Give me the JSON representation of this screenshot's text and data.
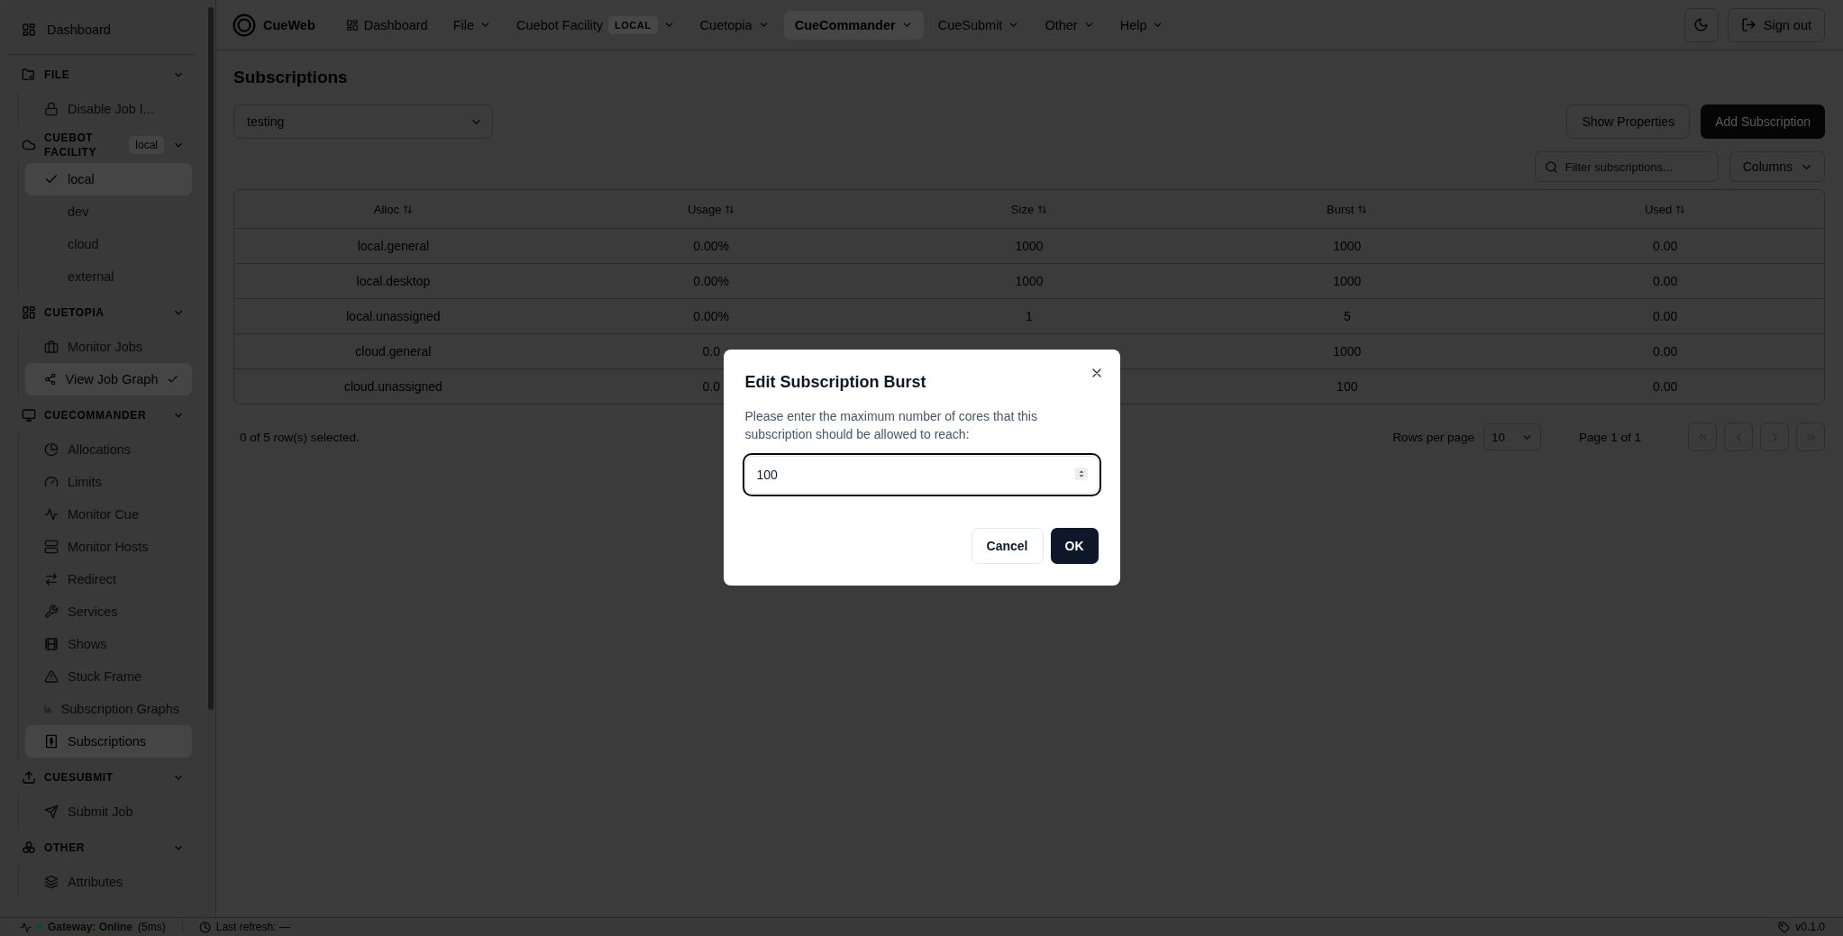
{
  "topbar": {
    "app_name": "CueWeb",
    "nav": [
      {
        "label": "Dashboard",
        "kind": "link",
        "selected": false
      },
      {
        "label": "File",
        "kind": "menu",
        "selected": false
      },
      {
        "label": "Cuebot Facility",
        "badge": "LOCAL",
        "kind": "menu",
        "selected": false
      },
      {
        "label": "Cuetopia",
        "kind": "menu",
        "selected": false
      },
      {
        "label": "CueCommander",
        "kind": "menu",
        "selected": true
      },
      {
        "label": "CueSubmit",
        "kind": "menu",
        "selected": false
      },
      {
        "label": "Other",
        "kind": "menu",
        "selected": false
      },
      {
        "label": "Help",
        "kind": "menu",
        "selected": false
      }
    ],
    "sign_out": "Sign out"
  },
  "sidebar": {
    "top_item": "Dashboard",
    "sections": [
      {
        "title": "FILE",
        "expanded": true,
        "items": [
          {
            "label": "Disable Job I...",
            "kind": "link",
            "selected": false,
            "checked": false
          }
        ]
      },
      {
        "title": "CUEBOT FACILITY",
        "badge": "local",
        "expanded": true,
        "items": [
          {
            "label": "local",
            "kind": "option",
            "selected": true,
            "checked": true
          },
          {
            "label": "dev",
            "kind": "option",
            "selected": false,
            "checked": false
          },
          {
            "label": "cloud",
            "kind": "option",
            "selected": false,
            "checked": false
          },
          {
            "label": "external",
            "kind": "option",
            "selected": false,
            "checked": false
          }
        ]
      },
      {
        "title": "CUETOPIA",
        "expanded": true,
        "items": [
          {
            "label": "Monitor Jobs",
            "kind": "link",
            "selected": false,
            "checked": false
          },
          {
            "label": "View Job Graph",
            "kind": "link",
            "selected": true,
            "checked": true
          }
        ]
      },
      {
        "title": "CUECOMMANDER",
        "expanded": true,
        "items": [
          {
            "label": "Allocations",
            "kind": "link",
            "selected": false,
            "checked": false
          },
          {
            "label": "Limits",
            "kind": "link",
            "selected": false,
            "checked": false
          },
          {
            "label": "Monitor Cue",
            "kind": "link",
            "selected": false,
            "checked": false
          },
          {
            "label": "Monitor Hosts",
            "kind": "link",
            "selected": false,
            "checked": false
          },
          {
            "label": "Redirect",
            "kind": "link",
            "selected": false,
            "checked": false
          },
          {
            "label": "Services",
            "kind": "link",
            "selected": false,
            "checked": false
          },
          {
            "label": "Shows",
            "kind": "link",
            "selected": false,
            "checked": false
          },
          {
            "label": "Stuck Frame",
            "kind": "link",
            "selected": false,
            "checked": false
          },
          {
            "label": "Subscription Graphs",
            "kind": "link",
            "selected": false,
            "checked": false
          },
          {
            "label": "Subscriptions",
            "kind": "link",
            "selected": true,
            "checked": false
          }
        ]
      },
      {
        "title": "CUESUBMIT",
        "expanded": true,
        "items": [
          {
            "label": "Submit Job",
            "kind": "link",
            "selected": false,
            "checked": false
          }
        ]
      },
      {
        "title": "OTHER",
        "expanded": true,
        "items": [
          {
            "label": "Attributes",
            "kind": "link",
            "selected": false,
            "checked": false
          }
        ]
      }
    ]
  },
  "page": {
    "title": "Subscriptions",
    "show_select": {
      "value": "testing"
    },
    "buttons": [
      {
        "label": "Show Properties",
        "kind": "outline"
      },
      {
        "label": "Add Subscription",
        "kind": "primary"
      }
    ],
    "filter": {
      "placeholder": "Filter subscriptions..."
    },
    "columns_button": "Columns",
    "table": {
      "columns": [
        "Alloc",
        "Usage",
        "Size",
        "Burst",
        "Used"
      ],
      "rows": [
        {
          "alloc": "local.general",
          "usage": "0.00%",
          "size": "1000",
          "burst": "1000",
          "used": "0.00"
        },
        {
          "alloc": "local.desktop",
          "usage": "0.00%",
          "size": "1000",
          "burst": "1000",
          "used": "0.00"
        },
        {
          "alloc": "local.unassigned",
          "usage": "0.00%",
          "size": "1",
          "burst": "5",
          "used": "0.00"
        },
        {
          "alloc": "cloud.general",
          "usage": "0.0",
          "burst": "1000",
          "used": "0.00"
        },
        {
          "alloc": "cloud.unassigned",
          "usage": "0.0",
          "burst": "100",
          "used": "0.00"
        }
      ]
    },
    "selection_text": "0 of 5 row(s) selected.",
    "rows_per_page": {
      "label": "Rows per page",
      "value": "10"
    },
    "page_info": "Page 1 of 1",
    "pager": [
      {
        "kind": "first",
        "disabled": true
      },
      {
        "kind": "previous",
        "disabled": true
      },
      {
        "kind": "next",
        "disabled": true
      },
      {
        "kind": "last",
        "disabled": true
      }
    ]
  },
  "dialog": {
    "title": "Edit Subscription Burst",
    "message": "Please enter the maximum number of cores that this subscription should be allowed to reach:",
    "value": "100",
    "buttons": [
      {
        "label": "Cancel",
        "kind": "outline"
      },
      {
        "label": "OK",
        "kind": "primary"
      }
    ]
  },
  "status_bar": {
    "gateway": "Gateway: Online",
    "online": true,
    "latency": "(5ms)",
    "last_refresh": "Last refresh: —",
    "version": "v0.1.0"
  }
}
